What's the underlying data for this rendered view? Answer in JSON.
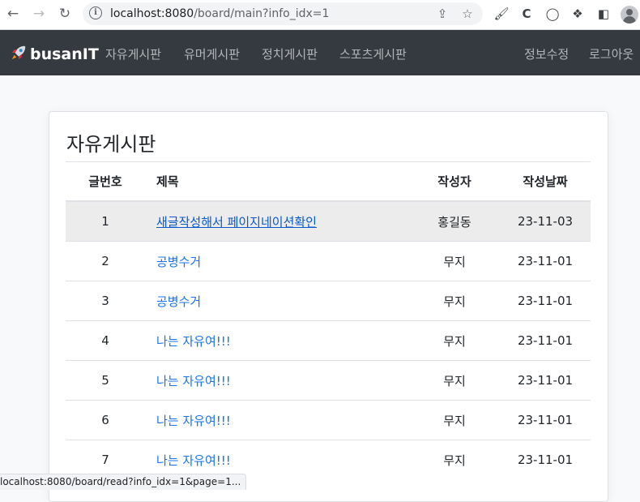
{
  "browser": {
    "url_host": "localhost:8080",
    "url_path": "/board/main?info_idx=1",
    "status_url": "localhost:8080/board/read?info_idx=1&page=1..."
  },
  "navbar": {
    "brand": "busanIT",
    "links": [
      "자유게시판",
      "유머게시판",
      "정치게시판",
      "스포츠게시판"
    ],
    "right_links": [
      "정보수정",
      "로그아웃"
    ]
  },
  "board": {
    "title": "자유게시판",
    "columns": [
      "글번호",
      "제목",
      "작성자",
      "작성날짜"
    ],
    "rows": [
      {
        "no": "1",
        "title": "새글작성해서 페이지네이션확인",
        "writer": "홍길동",
        "date": "23-11-03"
      },
      {
        "no": "2",
        "title": "공병수거",
        "writer": "무지",
        "date": "23-11-01"
      },
      {
        "no": "3",
        "title": "공병수거",
        "writer": "무지",
        "date": "23-11-01"
      },
      {
        "no": "4",
        "title": "나는 자유여!!!",
        "writer": "무지",
        "date": "23-11-01"
      },
      {
        "no": "5",
        "title": "나는 자유여!!!",
        "writer": "무지",
        "date": "23-11-01"
      },
      {
        "no": "6",
        "title": "나는 자유여!!!",
        "writer": "무지",
        "date": "23-11-01"
      },
      {
        "no": "7",
        "title": "나는 자유여!!!",
        "writer": "무지",
        "date": "23-11-01"
      }
    ]
  },
  "colors": {
    "navbar_bg": "#343a40",
    "link": "#1a73e8",
    "row_hover": "#ececec"
  }
}
